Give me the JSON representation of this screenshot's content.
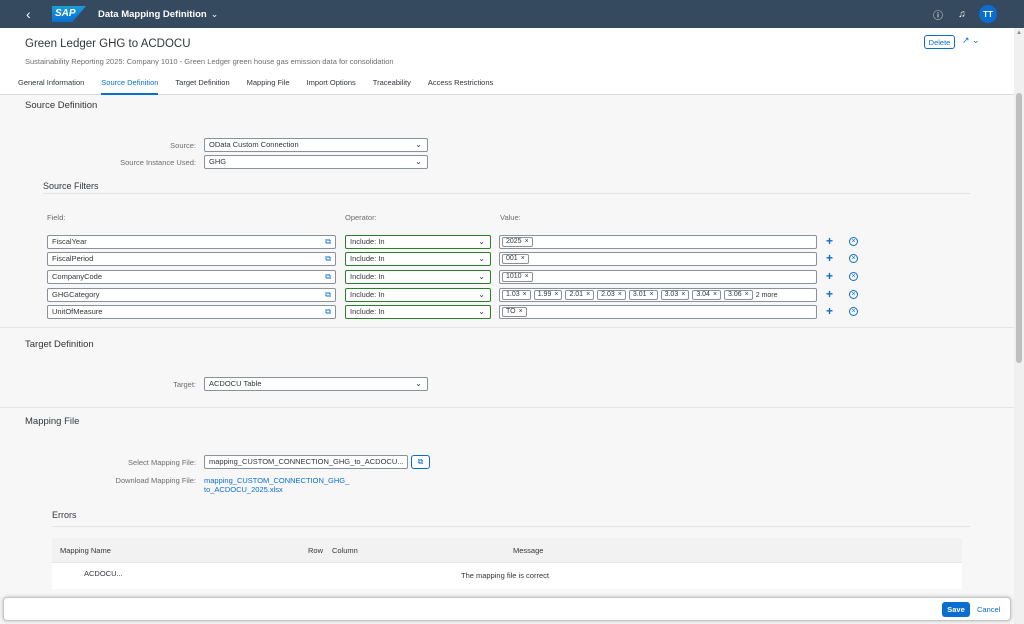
{
  "shell": {
    "logo": "SAP",
    "app_title": "Data Mapping Definition",
    "avatar_initials": "TT"
  },
  "header": {
    "title": "Green Ledger GHG to ACDOCU",
    "subtitle": "Sustainability Reporting 2025: Company 1010 - Green Ledger green house gas emission data for consolidation",
    "delete_label": "Delete"
  },
  "tabs": [
    {
      "label": "General Information"
    },
    {
      "label": "Source Definition"
    },
    {
      "label": "Target Definition"
    },
    {
      "label": "Mapping File"
    },
    {
      "label": "Import Options"
    },
    {
      "label": "Traceability"
    },
    {
      "label": "Access Restrictions"
    }
  ],
  "source_definition": {
    "title": "Source Definition",
    "source_label": "Source:",
    "source_value": "OData Custom Connection",
    "instance_label": "Source Instance Used:",
    "instance_value": "GHG",
    "filters_title": "Source Filters",
    "col_field": "Field:",
    "col_operator": "Operator:",
    "col_value": "Value:",
    "filters": [
      {
        "field": "FiscalYear",
        "operator": "Include: In",
        "tokens": [
          "2025"
        ],
        "more": ""
      },
      {
        "field": "FiscalPeriod",
        "operator": "Include: In",
        "tokens": [
          "001"
        ],
        "more": ""
      },
      {
        "field": "CompanyCode",
        "operator": "Include: In",
        "tokens": [
          "1010"
        ],
        "more": ""
      },
      {
        "field": "GHGCategory",
        "operator": "Include: In",
        "tokens": [
          "1.03",
          "1.99",
          "2.01",
          "2.03",
          "3.01",
          "3.03",
          "3.04",
          "3.06"
        ],
        "more": "2 more"
      },
      {
        "field": "UnitOfMeasure",
        "operator": "Include: In",
        "tokens": [
          "TO"
        ],
        "more": ""
      }
    ]
  },
  "target_definition": {
    "title": "Target Definition",
    "target_label": "Target:",
    "target_value": "ACDOCU Table"
  },
  "mapping_file": {
    "title": "Mapping File",
    "select_label": "Select Mapping File:",
    "select_value": "mapping_CUSTOM_CONNECTION_GHG_to_ACDOCU...",
    "download_label": "Download Mapping File:",
    "download_link_line1": "mapping_CUSTOM_CONNECTION_GHG_",
    "download_link_line2": "to_ACDOCU_2025.xlsx"
  },
  "errors": {
    "title": "Errors",
    "columns": {
      "mapping_name": "Mapping Name",
      "row": "Row",
      "column": "Column",
      "message": "Message"
    },
    "rows": [
      {
        "mapping_name": "ACDOCU...",
        "row": "",
        "column": "",
        "message": "The mapping file is correct"
      }
    ]
  },
  "footer": {
    "save_label": "Save",
    "cancel_label": "Cancel"
  },
  "colors": {
    "shell_bg": "#354a5f",
    "accent": "#0a6ed1",
    "operator_border": "#2b7d2b"
  }
}
